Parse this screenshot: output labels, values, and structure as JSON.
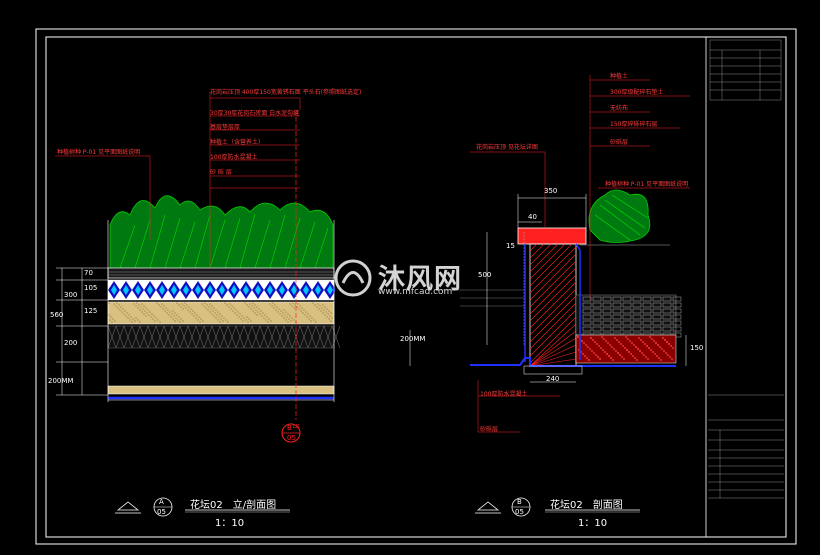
{
  "left_view": {
    "title": "花坛02　立/剖面图",
    "scale": "1：10",
    "callout_top": "A",
    "callout_bottom": "05",
    "labels": [
      "花岗岩压顶 400厚150宽黄锈石面 平头石(参照图纸选定)",
      "30厚30厚花岗石砖面 白水泥勾缝",
      "基层垫层厚",
      "种植土（含营养土）",
      "100厚防水混凝土",
      "砂 砾 层"
    ],
    "left_label": "种植树种 P-01 见平面图纸说明",
    "dims": [
      "70",
      "105",
      "300",
      "125",
      "560",
      "200",
      "200MM"
    ],
    "section_mark_top": "B",
    "section_mark_mid": "LD",
    "section_mark_bottom": "05"
  },
  "right_view": {
    "title": "花坛02　剖面图",
    "scale": "1：10",
    "callout_top": "B",
    "callout_bottom": "05",
    "labels": [
      "种植土",
      "300厚级配碎石垫土",
      "无纺布",
      "150厚碎砾碎石层",
      "砂砾层"
    ],
    "left_label": "花岗岩压顶 见花坛详图",
    "right_label": "种植树种 P-01 见平面图纸说明",
    "bottom_labels": [
      "100厚防水混凝土",
      "砂砾层"
    ],
    "dims": [
      "350",
      "40",
      "15",
      "500",
      "200MM",
      "240",
      "150"
    ]
  },
  "watermark": {
    "text": "沐风网",
    "url": "www.mfcad.com"
  },
  "colors": {
    "red": "#ff2020",
    "yellow": "#f0e000",
    "green": "#00c000",
    "blue": "#1010ff",
    "cyan": "#00e0ff"
  }
}
